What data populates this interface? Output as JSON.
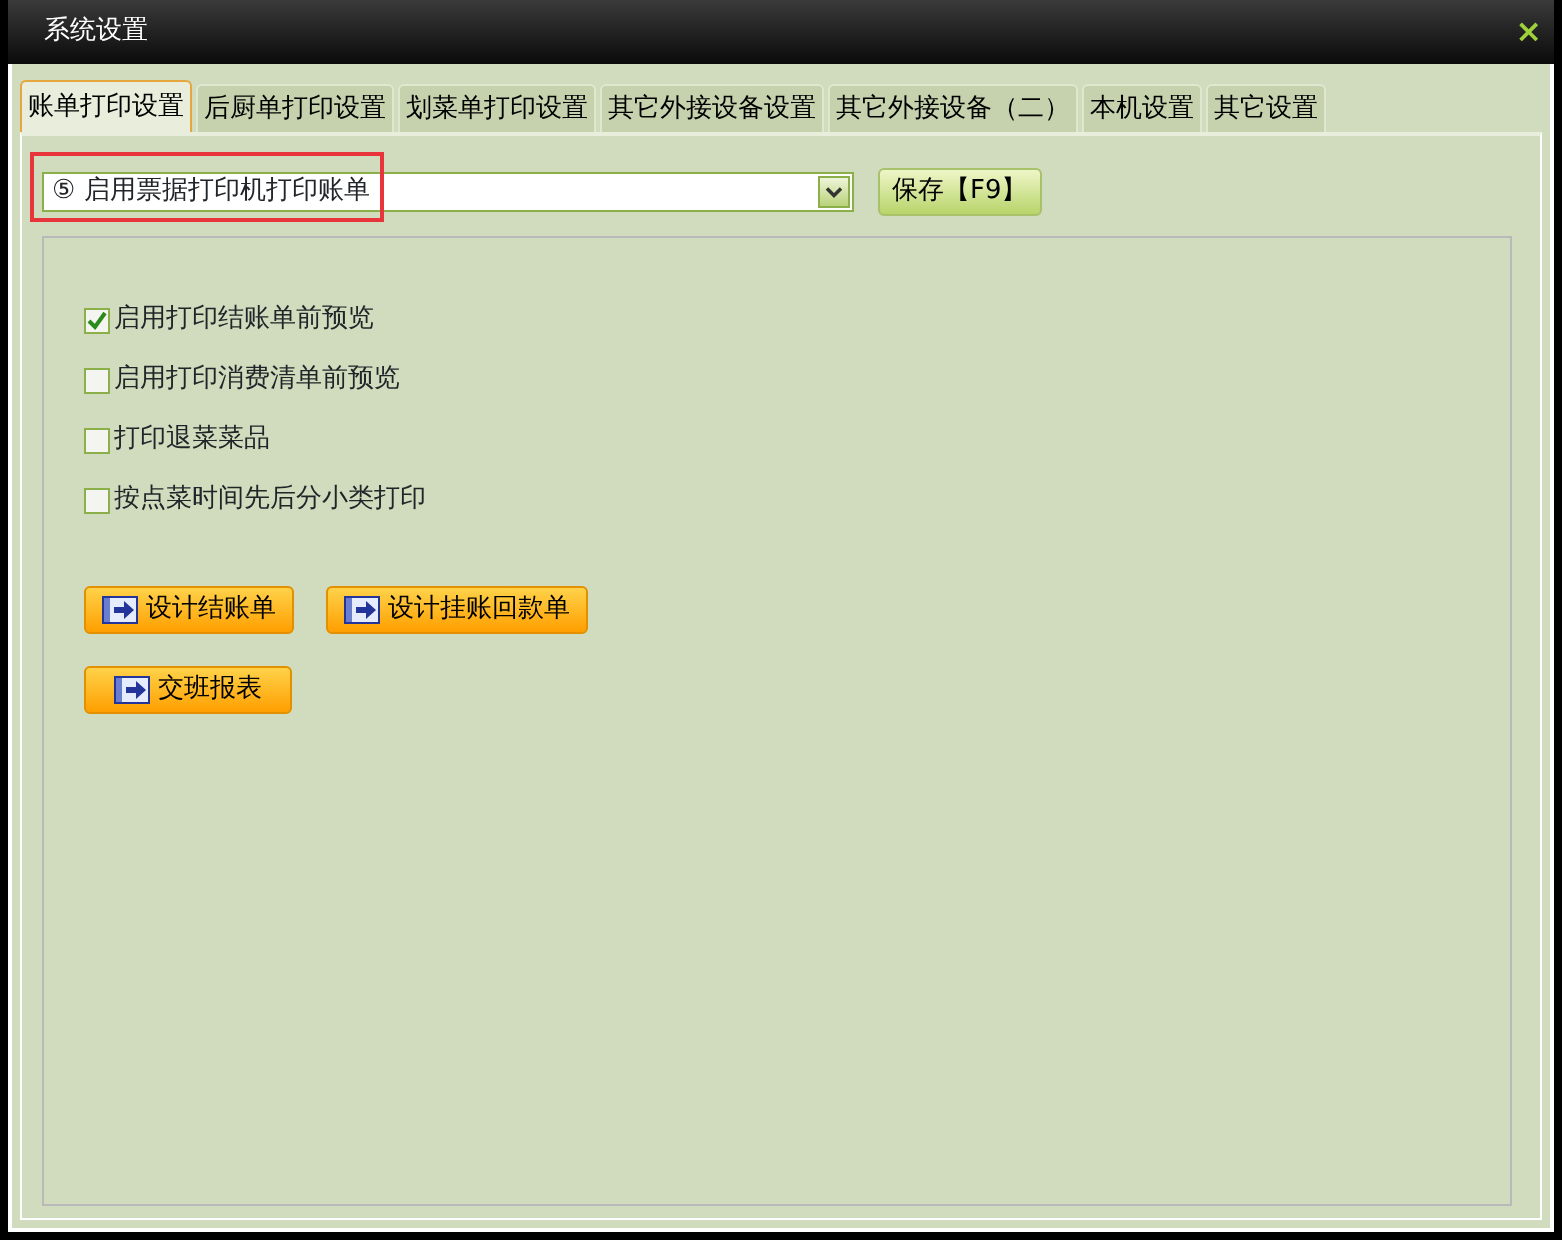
{
  "window": {
    "title": "系统设置",
    "close": "×"
  },
  "tabs": [
    {
      "label": "账单打印设置",
      "selected": true
    },
    {
      "label": "后厨单打印设置",
      "selected": false
    },
    {
      "label": "划菜单打印设置",
      "selected": false
    },
    {
      "label": "其它外接设备设置",
      "selected": false
    },
    {
      "label": "其它外接设备（二）",
      "selected": false
    },
    {
      "label": "本机设置",
      "selected": false
    },
    {
      "label": "其它设置",
      "selected": false
    }
  ],
  "mode_select": {
    "value": "⑤ 启用票据打印机打印账单",
    "highlighted": true
  },
  "save_button": "保存【F9】",
  "options": [
    {
      "label": "启用打印结账单前预览",
      "checked": true
    },
    {
      "label": "启用打印消费清单前预览",
      "checked": false
    },
    {
      "label": "打印退菜菜品",
      "checked": false
    },
    {
      "label": "按点菜时间先后分小类打印",
      "checked": false
    }
  ],
  "action_rows": [
    [
      "设计结账单",
      "设计挂账回款单"
    ],
    [
      "交班报表"
    ]
  ]
}
